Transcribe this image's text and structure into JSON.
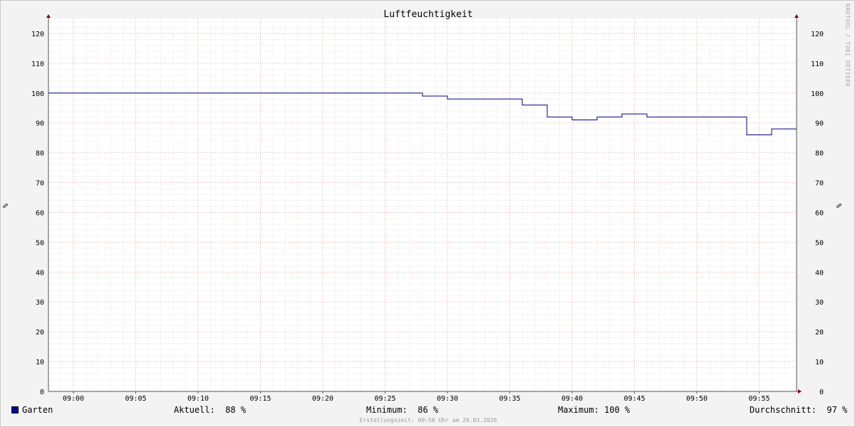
{
  "watermark": "RRDTOOL / TOBI OETIKER",
  "footer": "Erstellungszeit: 09:58 Uhr am 26.03.2026",
  "legend": {
    "series_name": "Garten",
    "current_label": "Aktuell:",
    "current_value": "88 %",
    "min_label": "Minimum:",
    "min_value": "86 %",
    "max_label": "Maximum:",
    "max_value": "100 %",
    "avg_label": "Durchschnitt:",
    "avg_value": "97 %"
  },
  "colors": {
    "series": "#000080",
    "swatch": "#0000a0",
    "major_grid": "#e8a0a0",
    "minor_grid": "#d0d0d0",
    "axis": "#555555",
    "arrow": "#800000"
  },
  "chart_data": {
    "type": "line",
    "title": "Luftfeuchtigkeit",
    "ylabel": "%",
    "ylabel_right": "%",
    "ylim": [
      0,
      125
    ],
    "yticks": [
      0,
      10,
      20,
      30,
      40,
      50,
      60,
      70,
      80,
      90,
      100,
      110,
      120
    ],
    "xlim": [
      "08:58",
      "09:58"
    ],
    "xticks": [
      "09:00",
      "09:05",
      "09:10",
      "09:15",
      "09:20",
      "09:25",
      "09:30",
      "09:35",
      "09:40",
      "09:45",
      "09:50",
      "09:55"
    ],
    "grid": true,
    "step": true,
    "series": [
      {
        "name": "Garten",
        "points": [
          [
            "08:58",
            100
          ],
          [
            "09:28",
            99
          ],
          [
            "09:30",
            98
          ],
          [
            "09:32",
            98
          ],
          [
            "09:36",
            96
          ],
          [
            "09:38",
            92
          ],
          [
            "09:40",
            91
          ],
          [
            "09:42",
            92
          ],
          [
            "09:44",
            93
          ],
          [
            "09:46",
            92
          ],
          [
            "09:48",
            92
          ],
          [
            "09:54",
            86
          ],
          [
            "09:56",
            88
          ],
          [
            "09:58",
            88
          ]
        ]
      }
    ]
  }
}
